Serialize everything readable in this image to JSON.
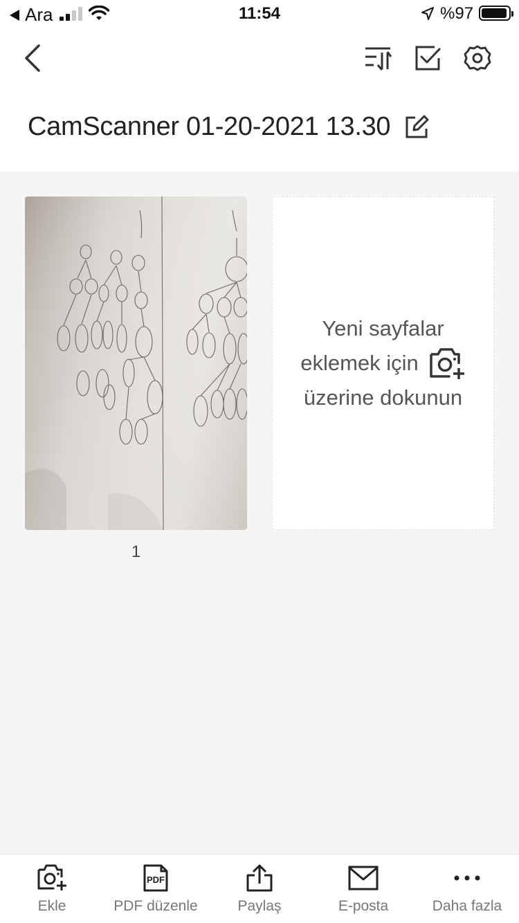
{
  "status_bar": {
    "back_app": "Ara",
    "time": "11:54",
    "battery": "%97"
  },
  "document": {
    "title": "CamScanner 01-20-2021 13.30"
  },
  "pages": [
    {
      "number": "1"
    }
  ],
  "add_card": {
    "line1": "Yeni sayfalar",
    "line2": "eklemek için",
    "line3": "üzerine dokunun"
  },
  "toolbar": {
    "items": [
      {
        "label": "Ekle",
        "icon": "camera-plus-icon"
      },
      {
        "label": "PDF düzenle",
        "icon": "pdf-icon"
      },
      {
        "label": "Paylaş",
        "icon": "share-icon"
      },
      {
        "label": "E-posta",
        "icon": "mail-icon"
      },
      {
        "label": "Daha fazla",
        "icon": "more-icon"
      }
    ]
  },
  "icons": {
    "nav": [
      "back-chevron-icon",
      "sort-icon",
      "select-checkbox-icon",
      "settings-gear-icon",
      "edit-icon"
    ]
  }
}
